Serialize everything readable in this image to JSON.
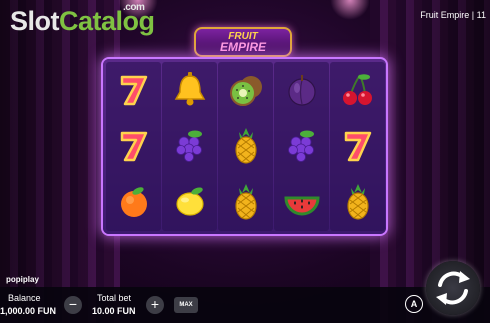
{
  "watermark": {
    "part1": "Slot",
    "part2": "Catalog",
    "suffix": ".com"
  },
  "game_title": "Fruit Empire | 11",
  "logo": {
    "line1": "FRUIT",
    "line2": "EMPIRE"
  },
  "reels": [
    [
      "seven-icon",
      "seven-icon",
      "orange-icon"
    ],
    [
      "bell-icon",
      "grapes-icon",
      "lemon-icon"
    ],
    [
      "kiwi-icon",
      "pineapple-icon",
      "pineapple-icon"
    ],
    [
      "plum-icon",
      "grapes-icon",
      "watermelon-icon"
    ],
    [
      "cherry-icon",
      "seven-icon",
      "pineapple-icon"
    ]
  ],
  "provider": "popiplay",
  "controls": {
    "balance_label": "Balance",
    "balance_value": "1,000.00 FUN",
    "total_bet_label": "Total bet",
    "total_bet_value": "10.00 FUN",
    "minus": "−",
    "plus": "+",
    "max_label": "MAX",
    "auto_label": "A"
  },
  "colors": {
    "accent_green": "#7fc242",
    "board_glow": "#c977ff"
  }
}
